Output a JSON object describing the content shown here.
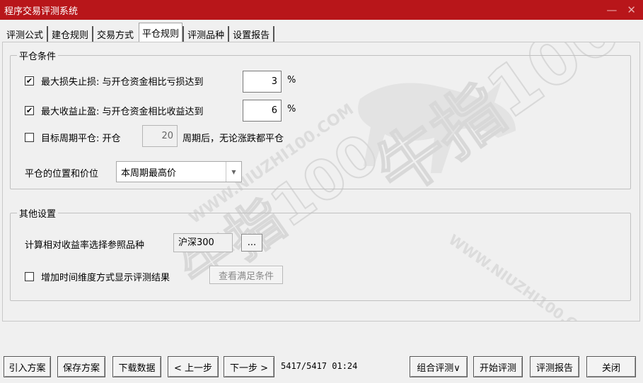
{
  "window": {
    "title": "程序交易评测系统",
    "minimize_glyph": "—",
    "close_glyph": "✕"
  },
  "tabs": [
    {
      "label": "评测公式"
    },
    {
      "label": "建仓规则"
    },
    {
      "label": "交易方式"
    },
    {
      "label": "平仓规则",
      "active": true
    },
    {
      "label": "评测品种"
    },
    {
      "label": "设置报告"
    }
  ],
  "close_group": {
    "title": "平仓条件",
    "max_loss": {
      "checked": true,
      "label": "最大损失止损: 与开仓资金相比亏损达到",
      "value": "3",
      "unit": "%"
    },
    "max_gain": {
      "checked": true,
      "label": "最大收益止盈: 与开仓资金相比收益达到",
      "value": "6",
      "unit": "%"
    },
    "target_period": {
      "checked": false,
      "label_before": "目标周期平仓: 开仓",
      "value": "20",
      "label_after": "周期后，无论涨跌都平仓"
    },
    "position_price": {
      "label": "平仓的位置和价位",
      "selected": "本周期最高价"
    }
  },
  "other_group": {
    "title": "其他设置",
    "benchmark": {
      "label": "计算相对收益率选择参照品种",
      "value": "沪深300",
      "browse_label": "..."
    },
    "time_dimension": {
      "checked": false,
      "label": "增加时间维度方式显示评测结果",
      "view_label": "查看满足条件"
    }
  },
  "watermark": {
    "brand": "牛指100",
    "domain": "WWW.NIUZHI100.COM"
  },
  "bottom": {
    "import_label": "引入方案",
    "save_label": "保存方案",
    "download_label": "下载数据",
    "prev_label": "< 上一步",
    "next_label": "下一步 >",
    "status": "5417/5417 01:24",
    "combo_label": "组合评测∨",
    "start_label": "开始评测",
    "report_label": "评测报告",
    "close_label": "关闭"
  }
}
